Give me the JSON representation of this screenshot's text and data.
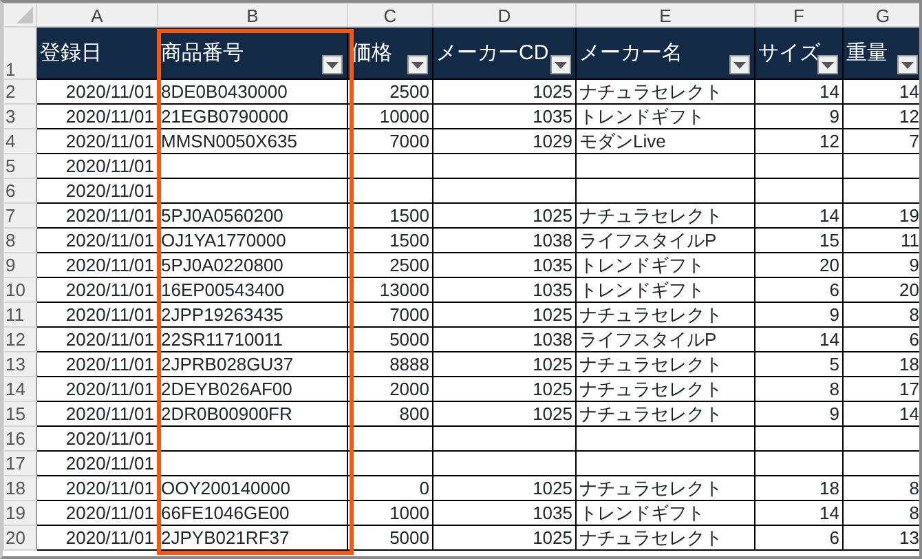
{
  "columns": [
    {
      "letter": "A",
      "header": "登録日",
      "kind": "date",
      "filter": false,
      "highlighted": false
    },
    {
      "letter": "B",
      "header": "商品番号",
      "kind": "text",
      "filter": true,
      "highlighted": true
    },
    {
      "letter": "C",
      "header": "価格",
      "kind": "number",
      "filter": true,
      "highlighted": false
    },
    {
      "letter": "D",
      "header": "メーカーCD",
      "kind": "number",
      "filter": true,
      "highlighted": false
    },
    {
      "letter": "E",
      "header": "メーカー名",
      "kind": "text",
      "filter": true,
      "highlighted": false
    },
    {
      "letter": "F",
      "header": "サイズ",
      "kind": "number",
      "filter": true,
      "highlighted": false
    },
    {
      "letter": "G",
      "header": "重量",
      "kind": "number",
      "filter": true,
      "highlighted": false
    }
  ],
  "header_row_number": "1",
  "rows": [
    {
      "number": "2",
      "cells": [
        "2020/11/01",
        "8DE0B0430000",
        "2500",
        "1025",
        "ナチュラセレクト",
        "14",
        "14"
      ]
    },
    {
      "number": "3",
      "cells": [
        "2020/11/01",
        "21EGB0790000",
        "10000",
        "1035",
        "トレンドギフト",
        "9",
        "12"
      ]
    },
    {
      "number": "4",
      "cells": [
        "2020/11/01",
        "MMSN0050X635",
        "7000",
        "1029",
        "モダンLive",
        "12",
        "7"
      ]
    },
    {
      "number": "5",
      "cells": [
        "2020/11/01",
        null,
        null,
        null,
        null,
        null,
        null
      ]
    },
    {
      "number": "6",
      "cells": [
        "2020/11/01",
        null,
        null,
        null,
        null,
        null,
        null
      ]
    },
    {
      "number": "7",
      "cells": [
        "2020/11/01",
        "5PJ0A0560200",
        "1500",
        "1025",
        "ナチュラセレクト",
        "14",
        "19"
      ]
    },
    {
      "number": "8",
      "cells": [
        "2020/11/01",
        "OJ1YA1770000",
        "1500",
        "1038",
        "ライフスタイルP",
        "15",
        "11"
      ]
    },
    {
      "number": "9",
      "cells": [
        "2020/11/01",
        "5PJ0A0220800",
        "2500",
        "1035",
        "トレンドギフト",
        "20",
        "9"
      ]
    },
    {
      "number": "10",
      "cells": [
        "2020/11/01",
        "16EP00543400",
        "13000",
        "1035",
        "トレンドギフト",
        "6",
        "20"
      ]
    },
    {
      "number": "11",
      "cells": [
        "2020/11/01",
        "2JPP19263435",
        "7000",
        "1025",
        "ナチュラセレクト",
        "9",
        "8"
      ]
    },
    {
      "number": "12",
      "cells": [
        "2020/11/01",
        "22SR11710011",
        "5000",
        "1038",
        "ライフスタイルP",
        "14",
        "6"
      ]
    },
    {
      "number": "13",
      "cells": [
        "2020/11/01",
        "2JPRB028GU37",
        "8888",
        "1025",
        "ナチュラセレクト",
        "5",
        "18"
      ]
    },
    {
      "number": "14",
      "cells": [
        "2020/11/01",
        "2DEYB026AF00",
        "2000",
        "1025",
        "ナチュラセレクト",
        "8",
        "17"
      ]
    },
    {
      "number": "15",
      "cells": [
        "2020/11/01",
        "2DR0B00900FR",
        "800",
        "1025",
        "ナチュラセレクト",
        "9",
        "14"
      ]
    },
    {
      "number": "16",
      "cells": [
        "2020/11/01",
        null,
        null,
        null,
        null,
        null,
        null
      ]
    },
    {
      "number": "17",
      "cells": [
        "2020/11/01",
        null,
        null,
        null,
        null,
        null,
        null
      ]
    },
    {
      "number": "18",
      "cells": [
        "2020/11/01",
        "OOY200140000",
        "0",
        "1025",
        "ナチュラセレクト",
        "18",
        "8"
      ]
    },
    {
      "number": "19",
      "cells": [
        "2020/11/01",
        "66FE1046GE00",
        "1000",
        "1035",
        "トレンドギフト",
        "14",
        "8"
      ]
    },
    {
      "number": "20",
      "cells": [
        "2020/11/01",
        "2JPYB021RF37",
        "5000",
        "1025",
        "ナチュラセレクト",
        "6",
        "13"
      ]
    }
  ]
}
